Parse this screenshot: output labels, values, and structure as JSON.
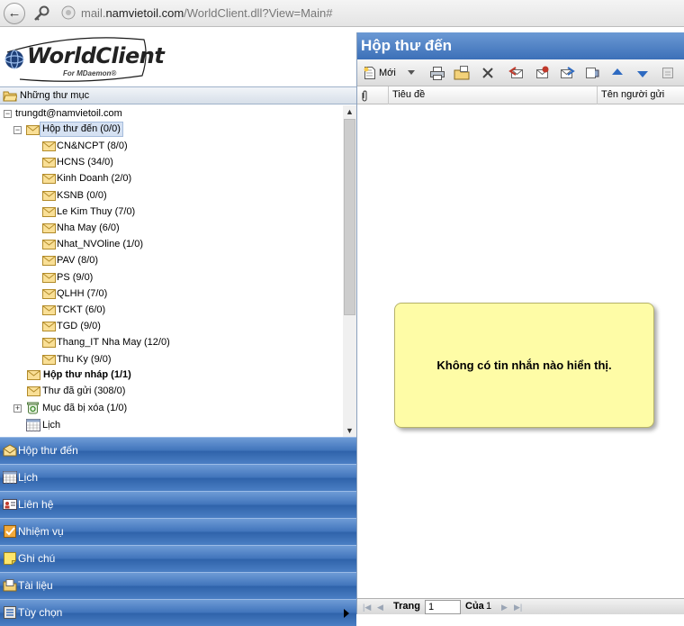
{
  "browser": {
    "url_prefix": "mail.",
    "url_domain": "namvietoil.com",
    "url_path": "/WorldClient.dll?View=Main#"
  },
  "brand": {
    "logo_text": "WorldClient",
    "logo_sub": "For MDaemon®"
  },
  "folders": {
    "header": "Những thư mục",
    "account": "trungdt@namvietoil.com",
    "inbox": "Hộp thư đến (0/0)",
    "subfolders": [
      "CN&NCPT (8/0)",
      "HCNS (34/0)",
      "Kinh Doanh (2/0)",
      "KSNB (0/0)",
      "Le Kim Thuy (7/0)",
      "Nha May (6/0)",
      "Nhat_NVOline (1/0)",
      "PAV (8/0)",
      "PS (9/0)",
      "QLHH (7/0)",
      "TCKT (6/0)",
      "TGD (9/0)",
      "Thang_IT Nha May (12/0)",
      "Thu Ky (9/0)"
    ],
    "drafts": "Hộp thư nháp (1/1)",
    "sent": "Thư đã gửi (308/0)",
    "trash": "Mục đã bị xóa (1/0)",
    "calendar": "Lịch"
  },
  "nav": {
    "inbox": "Hộp thư đến",
    "calendar": "Lịch",
    "contacts": "Liên hệ",
    "tasks": "Nhiệm vụ",
    "notes": "Ghi chú",
    "documents": "Tài liệu",
    "options": "Tùy chọn"
  },
  "main": {
    "title": "Hộp thư đến",
    "new_label": "Mới",
    "col_subject": "Tiêu đề",
    "col_sender": "Tên người gửi",
    "empty_message": "Không có tin nhắn nào hiển thị."
  },
  "pager": {
    "page_label": "Trang",
    "page_value": "1",
    "of_label": "Của",
    "total": "1"
  },
  "colors": {
    "nav_blue": "#3f73ba",
    "message_box_yellow": "#fefca6"
  }
}
